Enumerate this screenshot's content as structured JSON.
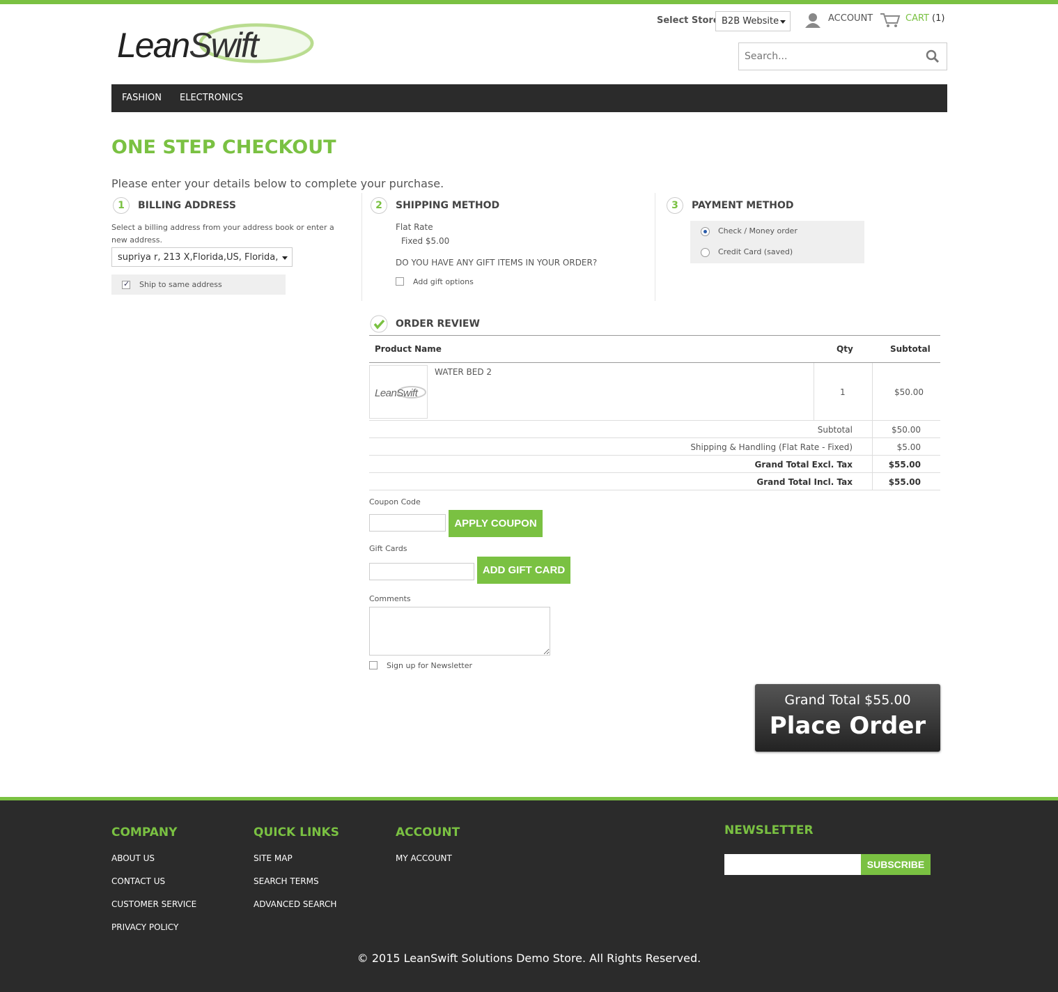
{
  "header": {
    "logo_text": "LeanSwift",
    "store_label": "Select Store:",
    "store_value": "B2B Website",
    "account_label": "ACCOUNT",
    "cart_label": "CART",
    "cart_count": "(1)",
    "search_placeholder": "Search..."
  },
  "nav": {
    "items": [
      "FASHION",
      "ELECTRONICS"
    ]
  },
  "page": {
    "title": "ONE STEP CHECKOUT",
    "intro": "Please enter your details below to complete your purchase."
  },
  "billing": {
    "step": "1",
    "title": "BILLING ADDRESS",
    "hint": "Select a billing address from your address book or enter a new address.",
    "address": "supriya r, 213 X,Florida,US, Florida,",
    "ship_same_label": "Ship to same address",
    "ship_same_checked": true
  },
  "shipping": {
    "step": "2",
    "title": "SHIPPING METHOD",
    "method_name": "Flat Rate",
    "method_price": "Fixed $5.00",
    "gift_question": "DO YOU HAVE ANY GIFT ITEMS IN YOUR ORDER?",
    "gift_label": "Add gift options"
  },
  "payment": {
    "step": "3",
    "title": "PAYMENT METHOD",
    "options": [
      "Check / Money order",
      "Credit Card (saved)"
    ],
    "selected": "Check / Money order"
  },
  "review": {
    "title": "ORDER REVIEW",
    "headers": {
      "product": "Product Name",
      "qty": "Qty",
      "subtotal": "Subtotal"
    },
    "items": [
      {
        "thumb_text": "LeanSwift",
        "name": "WATER BED 2",
        "qty": "1",
        "subtotal": "$50.00"
      }
    ],
    "totals": [
      {
        "label": "Subtotal",
        "value": "$50.00"
      },
      {
        "label": "Shipping & Handling (Flat Rate - Fixed)",
        "value": "$5.00"
      },
      {
        "label": "Grand Total Excl. Tax",
        "value": "$55.00"
      },
      {
        "label": "Grand Total Incl. Tax",
        "value": "$55.00"
      }
    ]
  },
  "coupon": {
    "label": "Coupon Code",
    "button": "APPLY COUPON",
    "value": ""
  },
  "giftcard": {
    "label": "Gift Cards",
    "button": "ADD GIFT CARD",
    "value": ""
  },
  "comments": {
    "label": "Comments",
    "value": ""
  },
  "newsletter_signup": {
    "label": "Sign up for Newsletter"
  },
  "place_order": {
    "grand_total": "Grand Total $55.00",
    "label": "Place Order"
  },
  "footer": {
    "company": {
      "title": "COMPANY",
      "links": [
        "ABOUT US",
        "CONTACT US",
        "CUSTOMER SERVICE",
        "PRIVACY POLICY"
      ]
    },
    "quick_links": {
      "title": "QUICK LINKS",
      "links": [
        "SITE MAP",
        "SEARCH TERMS",
        "ADVANCED SEARCH"
      ]
    },
    "account": {
      "title": "ACCOUNT",
      "links": [
        "MY ACCOUNT"
      ]
    },
    "newsletter": {
      "title": "NEWSLETTER",
      "button": "SUBSCRIBE"
    },
    "copyright": "© 2015 LeanSwift Solutions Demo Store. All Rights Reserved."
  },
  "colors": {
    "accent": "#7ac142",
    "dark": "#2b2b2b"
  }
}
